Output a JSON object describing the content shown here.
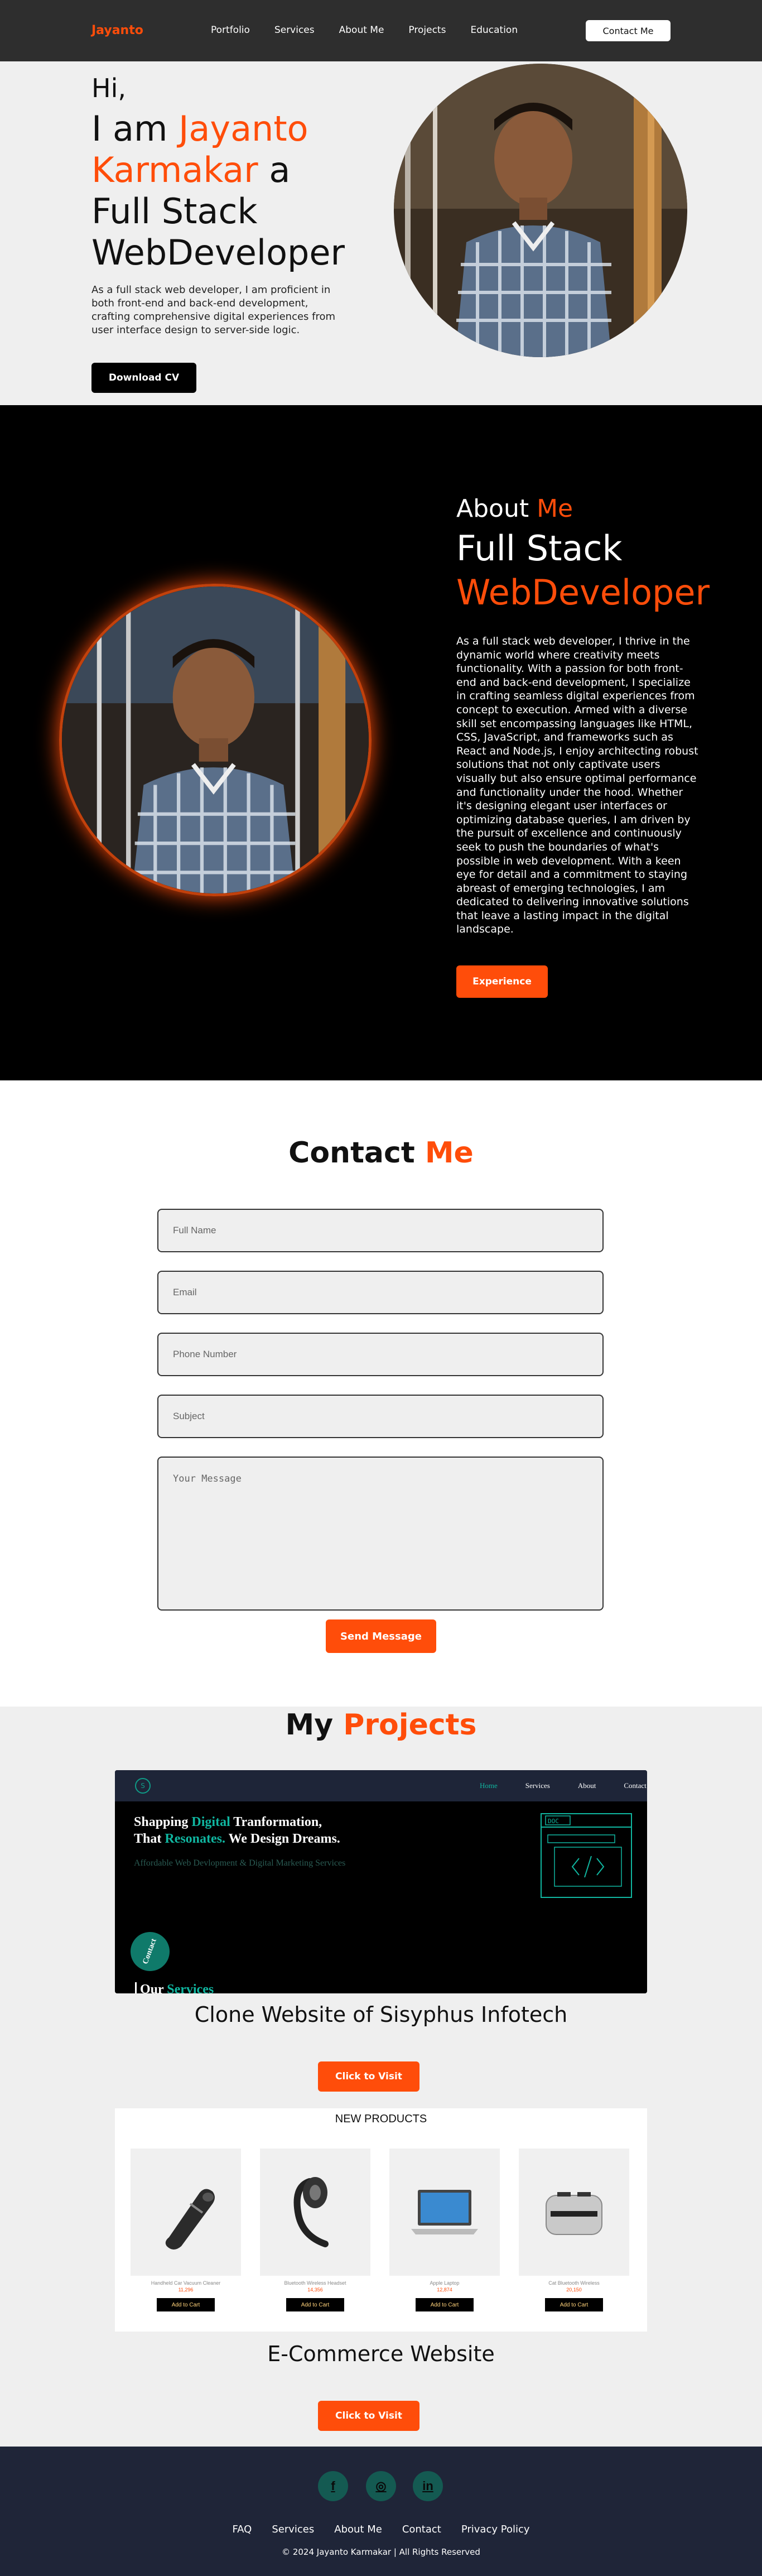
{
  "nav": {
    "logo": "Jayanto",
    "items": [
      "Portfolio",
      "Services",
      "About Me",
      "Projects",
      "Education"
    ],
    "contact_button": "Contact Me"
  },
  "hero": {
    "greeting": "Hi,",
    "intro_prefix": "I am ",
    "name": "Jayanto Karmakar",
    "intro_suffix": " a",
    "role_line1": "Full Stack",
    "role_line2": "WebDeveloper",
    "description": "As a full stack web developer, I am proficient in both front-end and back-end development, crafting comprehensive digital experiences from user interface design to server-side logic.",
    "download_button": "Download CV"
  },
  "about": {
    "heading_prefix": "About ",
    "heading_accent": "Me",
    "subheading1": "Full Stack",
    "subheading2": "WebDeveloper",
    "description": "As a full stack web developer, I thrive in the dynamic world where creativity meets functionality. With a passion for both front-end and back-end development, I specialize in crafting seamless digital experiences from concept to execution. Armed with a diverse skill set encompassing languages like HTML, CSS, JavaScript, and frameworks such as React and Node.js, I enjoy architecting robust solutions that not only captivate users visually but also ensure optimal performance and functionality under the hood. Whether it's designing elegant user interfaces or optimizing database queries, I am driven by the pursuit of excellence and continuously seek to push the boundaries of what's possible in web development. With a keen eye for detail and a commitment to staying abreast of emerging technologies, I am dedicated to delivering innovative solutions that leave a lasting impact in the digital landscape.",
    "experience_button": "Experience"
  },
  "contact": {
    "title_prefix": "Contact ",
    "title_accent": "Me",
    "placeholders": {
      "full_name": "Full Name",
      "email": "Email",
      "phone": "Phone Number",
      "subject": "Subject",
      "message": "Your Message"
    },
    "send_button": "Send Message"
  },
  "projects": {
    "title_prefix": "My ",
    "title_accent": "Projects",
    "project1": {
      "preview": {
        "logo": "S",
        "menu": [
          "Home",
          "Services",
          "About",
          "Contact"
        ],
        "headline1_a": "Shapping ",
        "headline1_b": "Digital",
        "headline1_c": " Tranformation,",
        "headline2_a": "That ",
        "headline2_b": "Resonates.",
        "headline2_c": " We Design Dreams.",
        "subline": "Affordable Web Devlopment & Digital Marketing Services",
        "badge": "Contact",
        "our": "Our ",
        "services": "Services",
        "code_label": "DOC"
      },
      "title": "Clone Website of Sisyphus Infotech",
      "visit_button": "Click to Visit"
    },
    "project2": {
      "preview": {
        "heading": "NEW PRODUCTS",
        "products": [
          {
            "name": "Handheld Car Vacuum Cleaner",
            "price": "11,296",
            "cart": "Add to Cart",
            "icon": "vacuum-icon"
          },
          {
            "name": "Bluetooth Wireless Headset",
            "price": "14,356",
            "cart": "Add to Cart",
            "icon": "headset-icon"
          },
          {
            "name": "Apple Laptop",
            "price": "12,874",
            "cart": "Add to Cart",
            "icon": "laptop-icon"
          },
          {
            "name": "Cat Bluetooth Wireless",
            "price": "20,150",
            "cart": "Add to Cart",
            "icon": "toaster-icon"
          }
        ]
      },
      "title": "E-Commerce Website",
      "visit_button": "Click to Visit"
    }
  },
  "footer": {
    "social": [
      {
        "icon": "facebook-icon",
        "glyph": "f"
      },
      {
        "icon": "instagram-icon",
        "glyph": "◎"
      },
      {
        "icon": "linkedin-icon",
        "glyph": "in"
      }
    ],
    "links": [
      "FAQ",
      "Services",
      "About Me",
      "Contact",
      "Privacy Policy"
    ],
    "copyright": "© 2024 Jayanto Karmakar | All Rights Reserved"
  },
  "colors": {
    "accent": "#ff4d0a",
    "nav_bg": "#2e2e2e",
    "footer_bg": "#1f2538",
    "teal": "#10b6a0"
  }
}
